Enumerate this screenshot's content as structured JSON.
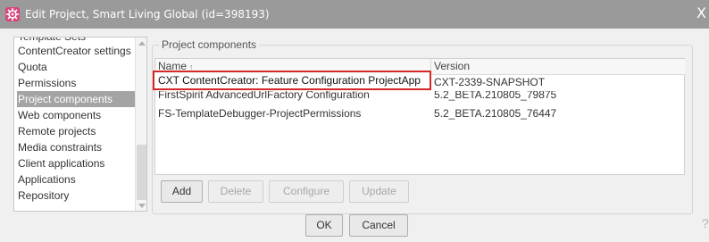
{
  "window": {
    "title": "Edit Project, Smart Living Global (id=398193)",
    "close_label": "X",
    "app_icon": "gear-icon"
  },
  "sidebar": {
    "items": [
      {
        "label": "Template Sets"
      },
      {
        "label": "ContentCreator settings"
      },
      {
        "label": "Quota"
      },
      {
        "label": "Permissions"
      },
      {
        "label": "Project components",
        "selected": true
      },
      {
        "label": "Web components"
      },
      {
        "label": "Remote projects"
      },
      {
        "label": "Media constraints"
      },
      {
        "label": "Client applications"
      },
      {
        "label": "Applications"
      },
      {
        "label": "Repository"
      }
    ]
  },
  "project_components": {
    "legend": "Project components",
    "columns": {
      "name": "Name",
      "version": "Version"
    },
    "sort_indicator": "↑",
    "rows": [
      {
        "name": "CXT ContentCreator: Feature Configuration ProjectApp",
        "version": "CXT-2339-SNAPSHOT",
        "highlighted": true
      },
      {
        "name": "FirstSpirit AdvancedUrlFactory Configuration",
        "version": "5.2_BETA.210805_79875"
      },
      {
        "name": "FS-TemplateDebugger-ProjectPermissions",
        "version": "5.2_BETA.210805_76447"
      }
    ],
    "buttons": {
      "add": "Add",
      "delete": "Delete",
      "configure": "Configure",
      "update": "Update"
    }
  },
  "footer": {
    "ok": "OK",
    "cancel": "Cancel",
    "help": "?"
  }
}
